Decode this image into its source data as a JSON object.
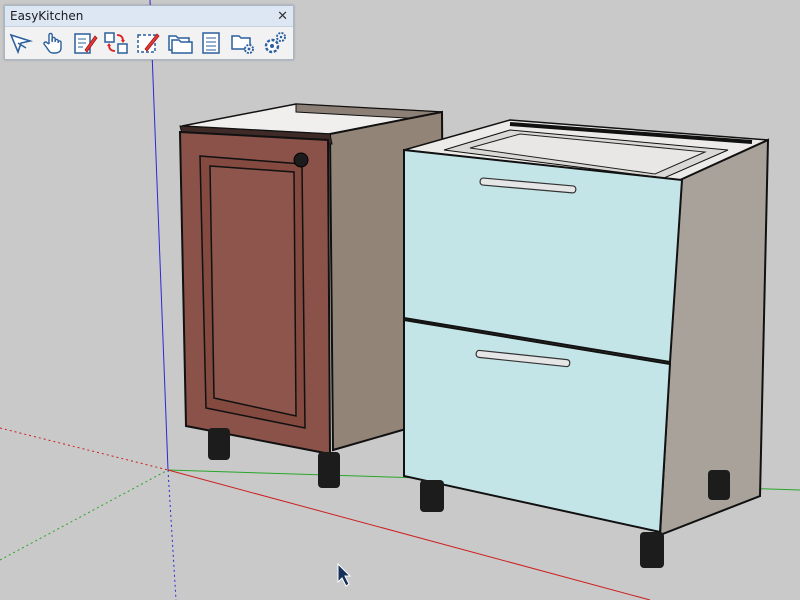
{
  "panel": {
    "title": "EasyKitchen",
    "close_glyph": "✕",
    "tools": [
      {
        "icon": "select-arrow-icon"
      },
      {
        "icon": "hand-icon"
      },
      {
        "icon": "edit-icon"
      },
      {
        "icon": "swap-icon"
      },
      {
        "icon": "select-edit-icon"
      },
      {
        "icon": "folders-icon"
      },
      {
        "icon": "list-document-icon"
      },
      {
        "icon": "folder-settings-icon"
      },
      {
        "icon": "settings-icon"
      }
    ]
  },
  "colors": {
    "ground": "#c8c8c8",
    "red_door": "#8a5249",
    "cabinet_side": "#938478",
    "drawer_blue": "#c4e5e8",
    "axis_red": "#cc2020",
    "axis_blue": "#2222cc",
    "axis_green": "#1e9b1e"
  }
}
